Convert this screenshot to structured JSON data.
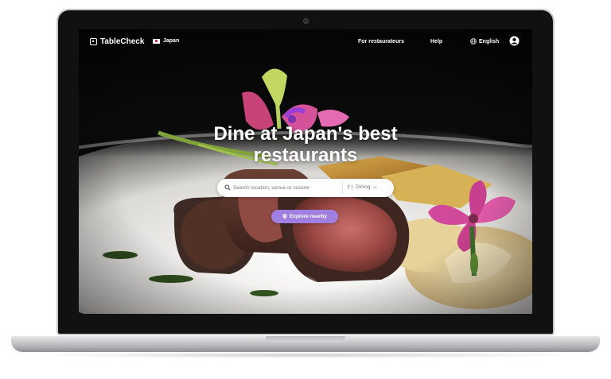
{
  "nav": {
    "brand": "TableCheck",
    "country": "Japan",
    "for_restaurateurs": "For restaurateurs",
    "help": "Help",
    "language": "English"
  },
  "hero": {
    "headline_line1": "Dine at Japan's best",
    "headline_line2": "restaurants"
  },
  "search": {
    "placeholder": "Search location, venue or cuisine",
    "category": "Dining"
  },
  "explore": {
    "label": "Explore nearby"
  },
  "colors": {
    "accent_purple": "#9f7fe0",
    "nav_text": "#ffffff",
    "background_dark": "#060606"
  },
  "icons": {
    "logo": "tablecheck-logo-icon",
    "flag": "japan-flag-icon",
    "globe": "globe-icon",
    "user": "user-icon",
    "search": "search-icon",
    "cutlery": "cutlery-icon",
    "chevron": "chevron-down-icon",
    "pin": "location-pin-icon"
  }
}
